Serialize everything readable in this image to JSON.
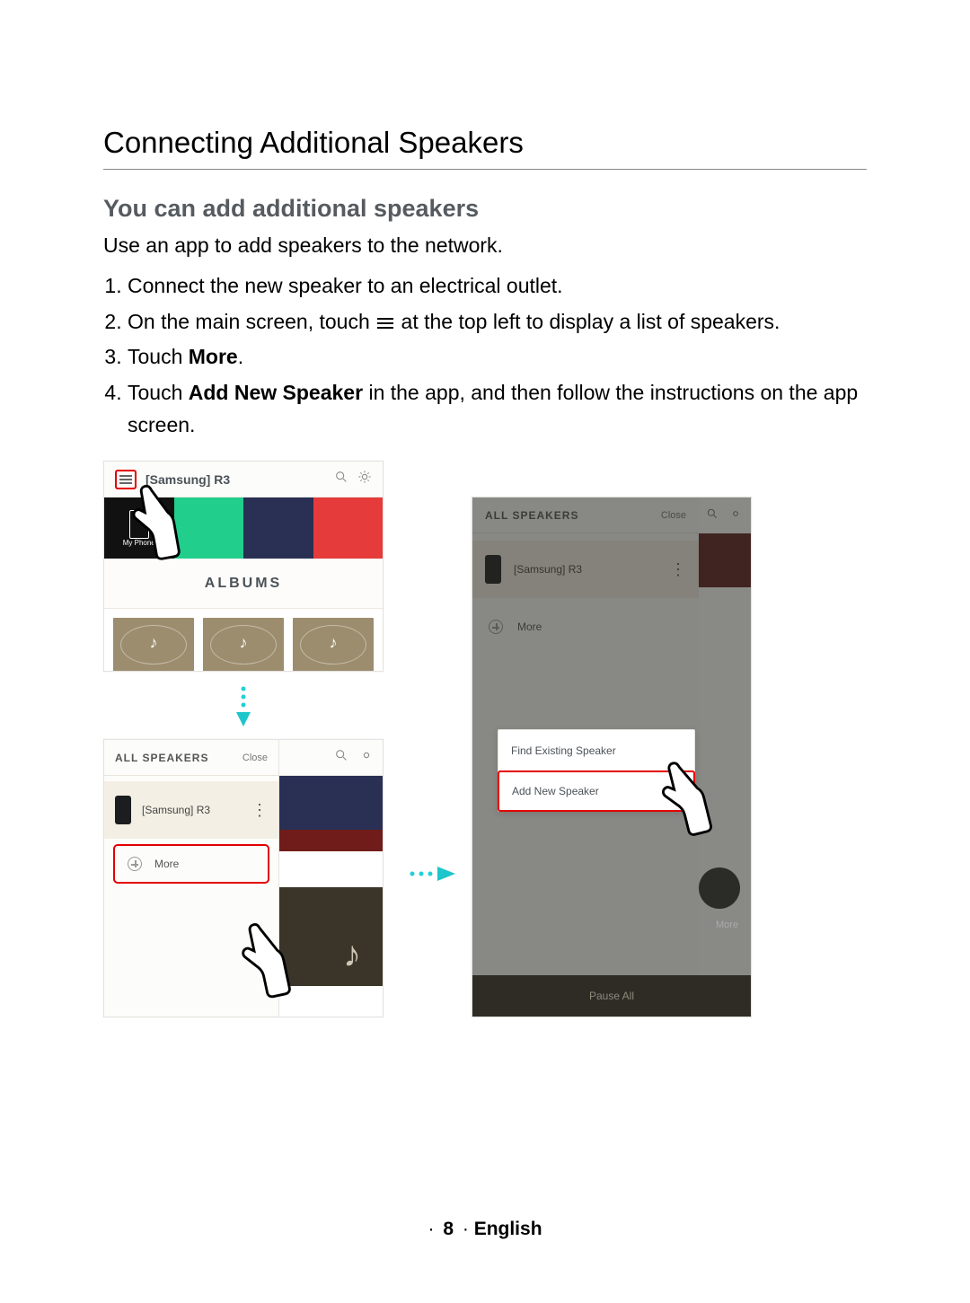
{
  "heading": "Connecting Additional Speakers",
  "subheading": "You can add additional speakers",
  "intro": "Use an app to add speakers to the network.",
  "steps": {
    "s1": "Connect the new speaker to an electrical outlet.",
    "s2a": "On the main screen, touch ",
    "s2b": " at the top left to display a list of speakers.",
    "s3a": "Touch ",
    "s3b": "More",
    "s3c": ".",
    "s4a": "Touch ",
    "s4b": "Add New Speaker",
    "s4c": " in the app, and then follow the instructions on the app screen."
  },
  "mock1": {
    "title": "[Samsung] R3",
    "phoneLabel": "My Phone",
    "albums": "ALBUMS"
  },
  "mock2": {
    "drawerTitle": "ALL SPEAKERS",
    "close": "Close",
    "speaker": "[Samsung] R3",
    "more": "More"
  },
  "mock3": {
    "drawerTitle": "ALL SPEAKERS",
    "close": "Close",
    "speaker": "[Samsung] R3",
    "more": "More",
    "popFind": "Find Existing Speaker",
    "popAdd": "Add New Speaker",
    "bgMore": "More",
    "pause": "Pause All"
  },
  "footer": {
    "page": "8",
    "lang": "English"
  }
}
